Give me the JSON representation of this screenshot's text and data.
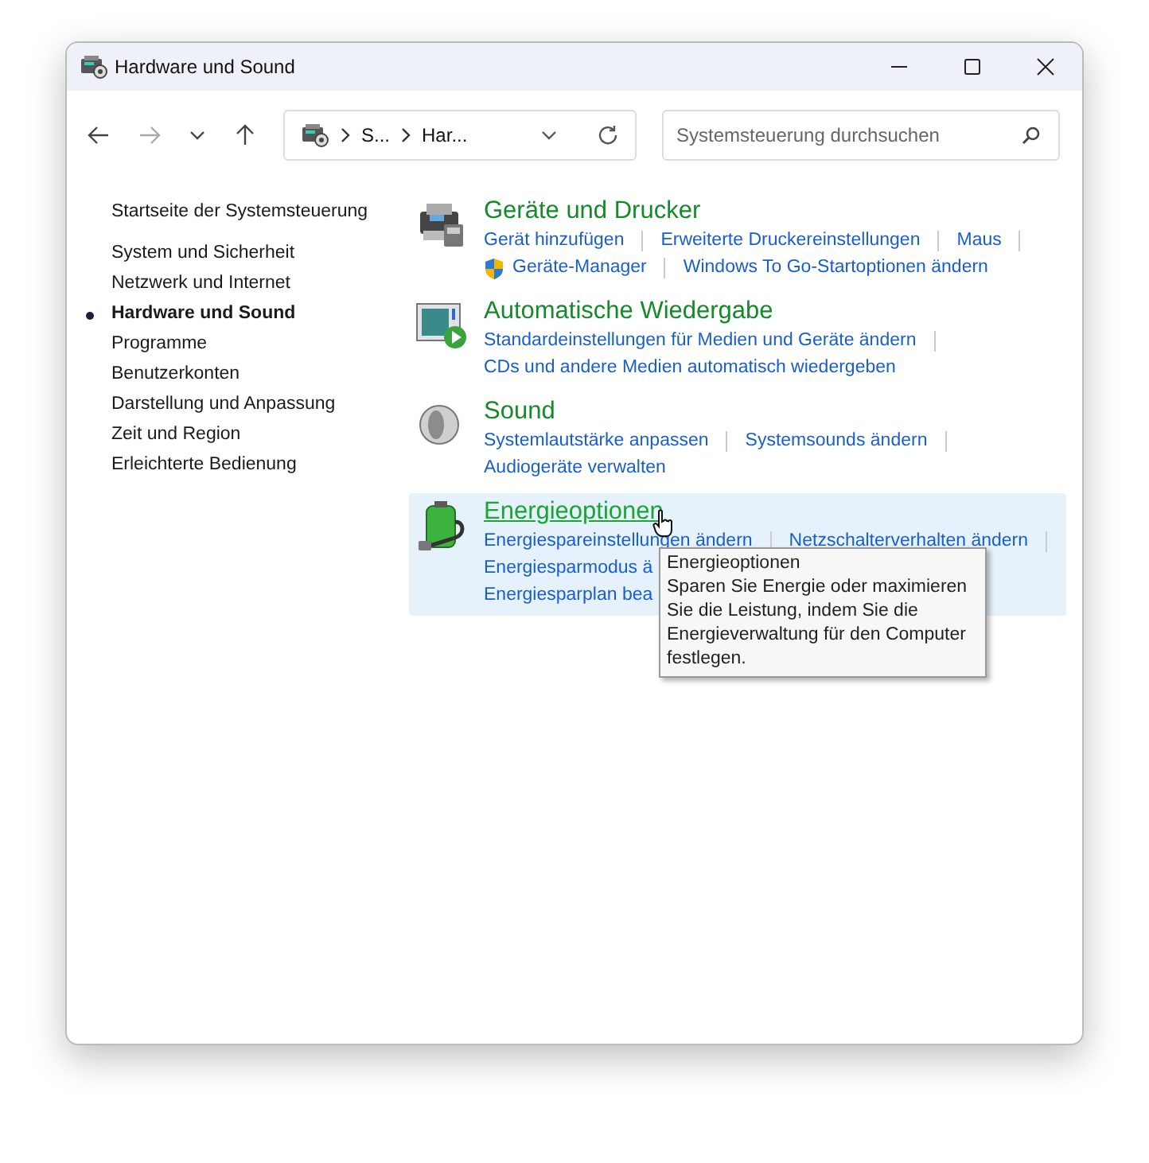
{
  "window": {
    "title": "Hardware und Sound"
  },
  "address_bar": {
    "crumbs": [
      "S...",
      "Har..."
    ]
  },
  "search": {
    "placeholder": "Systemsteuerung durchsuchen"
  },
  "sidebar": {
    "home": "Startseite der Systemsteuerung",
    "items": [
      {
        "label": "System und Sicherheit",
        "selected": false
      },
      {
        "label": "Netzwerk und Internet",
        "selected": false
      },
      {
        "label": "Hardware und Sound",
        "selected": true
      },
      {
        "label": "Programme",
        "selected": false
      },
      {
        "label": "Benutzerkonten",
        "selected": false
      },
      {
        "label": "Darstellung und Anpassung",
        "selected": false
      },
      {
        "label": "Zeit und Region",
        "selected": false
      },
      {
        "label": "Erleichterte Bedienung",
        "selected": false
      }
    ]
  },
  "categories": [
    {
      "title": "Geräte und Drucker",
      "hovered": false,
      "lines": [
        [
          {
            "label": "Gerät hinzufügen",
            "shield": false
          },
          {
            "label": "Erweiterte Druckereinstellungen",
            "shield": false
          },
          {
            "label": "Maus",
            "shield": false
          }
        ],
        [
          {
            "label": "Geräte-Manager",
            "shield": true
          },
          {
            "label": "Windows To Go-Startoptionen ändern",
            "shield": false
          }
        ]
      ]
    },
    {
      "title": "Automatische Wiedergabe",
      "hovered": false,
      "lines": [
        [
          {
            "label": "Standardeinstellungen für Medien und Geräte ändern",
            "shield": false
          }
        ],
        [
          {
            "label": "CDs und andere Medien automatisch wiedergeben",
            "shield": false
          }
        ]
      ]
    },
    {
      "title": "Sound",
      "hovered": false,
      "lines": [
        [
          {
            "label": "Systemlautstärke anpassen",
            "shield": false
          },
          {
            "label": "Systemsounds ändern",
            "shield": false
          }
        ],
        [
          {
            "label": "Audiogeräte verwalten",
            "shield": false
          }
        ]
      ]
    },
    {
      "title": "Energieoptionen",
      "hovered": true,
      "lines": [
        [
          {
            "label": "Energiespareinstellungen ändern",
            "shield": false
          },
          {
            "label": "Netzschalterverhalten ändern",
            "shield": false
          }
        ],
        [
          {
            "label": "Energiesparmodus ä",
            "shield": false
          }
        ],
        [
          {
            "label": "Energiesparplan bea",
            "shield": false
          }
        ]
      ]
    }
  ],
  "tooltip": {
    "title": "Energieoptionen",
    "text": "Sparen Sie Energie oder maximieren Sie die Leistung, indem Sie die Energieverwaltung für den Computer festlegen."
  }
}
